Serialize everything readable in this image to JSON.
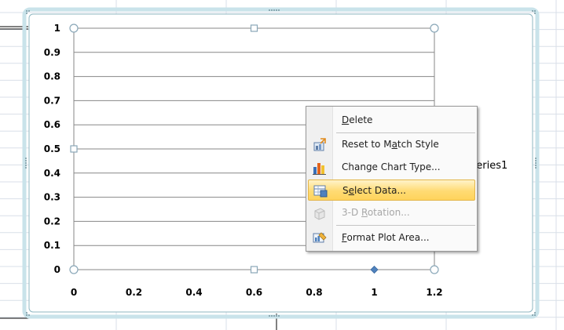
{
  "chart_data": {
    "type": "scatter",
    "series": [
      {
        "name": "Series1",
        "x": [
          1
        ],
        "y": [
          0
        ],
        "color": "#4f81bd"
      }
    ],
    "x_ticks": [
      "0",
      "0.2",
      "0.4",
      "0.6",
      "0.8",
      "1",
      "1.2"
    ],
    "y_ticks": [
      "0",
      "0.1",
      "0.2",
      "0.3",
      "0.4",
      "0.5",
      "0.6",
      "0.7",
      "0.8",
      "0.9",
      "1"
    ],
    "xlim": [
      0,
      1.2
    ],
    "ylim": [
      0,
      1
    ],
    "grid": true,
    "legend_position": "right"
  },
  "context_menu": {
    "items": [
      {
        "id": "delete",
        "label": "Delete",
        "accesskey": "D",
        "icon": "none",
        "enabled": true,
        "highlighted": false
      },
      {
        "id": "reset-style",
        "label": "Reset to Match Style",
        "accesskey": "a",
        "icon": "reset-style-icon",
        "enabled": true,
        "highlighted": false
      },
      {
        "id": "change-chart-type",
        "label": "Change Chart Type...",
        "accesskey": "Y",
        "icon": "chart-type-icon",
        "enabled": true,
        "highlighted": false
      },
      {
        "id": "select-data",
        "label": "Select Data...",
        "accesskey": "e",
        "icon": "select-data-icon",
        "enabled": true,
        "highlighted": true
      },
      {
        "id": "3d-rotation",
        "label": "3-D Rotation...",
        "accesskey": "R",
        "icon": "rotation-3d-icon",
        "enabled": false,
        "highlighted": false
      },
      {
        "id": "format-plot-area",
        "label": "Format Plot Area...",
        "accesskey": "F",
        "icon": "format-plot-area-icon",
        "enabled": true,
        "highlighted": false
      }
    ]
  },
  "colors": {
    "chart_border": "#a8cfd8",
    "gridline": "#878787",
    "highlight": "#ffd35c",
    "menu_background": "#fafafa"
  }
}
